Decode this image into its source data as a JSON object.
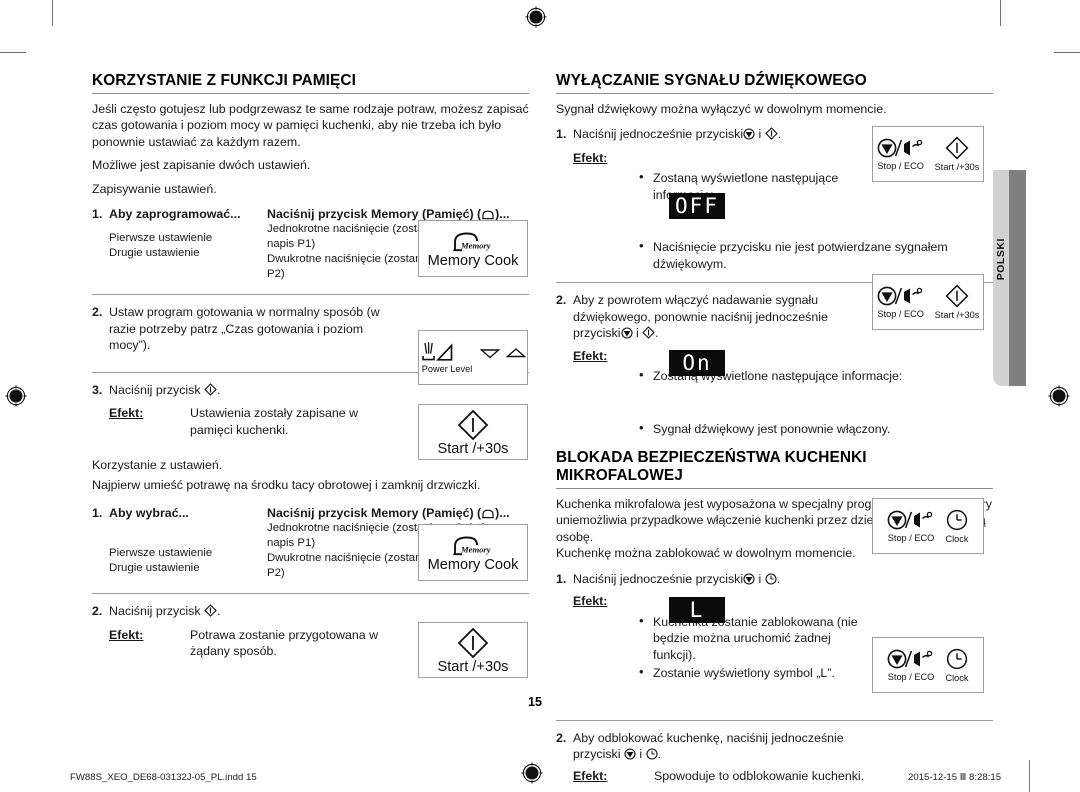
{
  "page": {
    "number": "15",
    "language_tab": "POLSKI",
    "footer_file": "FW88S_XEO_DE68-03132J-05_PL.indd   15",
    "footer_timestamp": "2015-12-15   Ⅲ 8:28:15"
  },
  "left_column": {
    "heading": "KORZYSTANIE Z FUNKCJI PAMIĘCI",
    "intro_1": "Jeśli często gotujesz lub podgrzewasz te same rodzaje potraw, możesz zapisać czas gotowania i poziom mocy w pamięci kuchenki, aby nie trzeba ich było ponownie ustawiać za każdym razem.",
    "intro_2": "Możliwe jest zapisanie dwóch ustawień.",
    "save_label": "Zapisywanie ustawień.",
    "step1": {
      "num": "1.",
      "col1_head": "Aby zaprogramować...",
      "col2_head": "Naciśnij przycisk Memory (Pamięć) (",
      "col2_head_tail": ")...",
      "rows": [
        {
          "c1": "Pierwsze ustawienie",
          "c2": "Jednokrotne naciśnięcie (zostanie wyświetlony napis P1)"
        },
        {
          "c1": "Drugie ustawienie",
          "c2": "Dwukrotne naciśnięcie (zostanie wyświetlony napis P2)"
        }
      ]
    },
    "step2": {
      "num": "2.",
      "text": "Ustaw program gotowania w normalny sposób (w razie potrzeby patrz „Czas gotowania i poziom mocy”)."
    },
    "step3": {
      "num": "3.",
      "text_pre": "Naciśnij przycisk ",
      "text_post": ".",
      "efekt_label": "Efekt:",
      "efekt_text": "Ustawienia zostały zapisane w pamięci kuchenki."
    },
    "use_label_1": "Korzystanie z ustawień.",
    "use_label_2": "Najpierw umieść potrawę na środku tacy obrotowej i zamknij drzwiczki.",
    "step4": {
      "num": "1.",
      "col1_head": "Aby wybrać...",
      "col2_head": "Naciśnij przycisk Memory (Pamięć) (",
      "col2_head_tail": ")...",
      "rows": [
        {
          "c1": "Pierwsze ustawienie",
          "c2": "Jednokrotne naciśnięcie (zostanie wyświetlony napis P1)"
        },
        {
          "c1": "Drugie ustawienie",
          "c2": "Dwukrotne naciśnięcie (zostanie wyświetlony napis P2)"
        }
      ]
    },
    "step5": {
      "num": "2.",
      "text_pre": "Naciśnij przycisk ",
      "text_post": ".",
      "efekt_label": "Efekt:",
      "efekt_text": "Potrawa zostanie przygotowana w żądany sposób."
    }
  },
  "right_column": {
    "heading_sound": "WYŁĄCZANIE SYGNAŁU DŹWIĘKOWEGO",
    "sound_intro": "Sygnał dźwiękowy można wyłączyć w dowolnym momencie.",
    "sound_step1": {
      "num": "1.",
      "text_pre": "Naciśnij jednocześnie przyciski",
      "text_mid": " i ",
      "text_post": ".",
      "efekt_label": "Efekt:",
      "bullet_1": "Zostaną wyświetlone następujące informacje:",
      "display_1": "OFF",
      "bullet_2": "Naciśnięcie przycisku nie jest potwierdzane sygnałem dźwiękowym."
    },
    "sound_step2": {
      "num": "2.",
      "text_pre": "Aby z powrotem włączyć nadawanie sygnału dźwiękowego, ponownie naciśnij jednocześnie przyciski",
      "text_mid": " i ",
      "text_post": ".",
      "efekt_label": "Efekt:",
      "bullet_1": "Zostaną wyświetlone następujące informacje:",
      "display_1": "On",
      "bullet_2": "Sygnał dźwiękowy jest ponownie włączony."
    },
    "heading_lock": "BLOKADA BEZPIECZEŃSTWA KUCHENKI MIKROFALOWEJ",
    "lock_intro_1": "Kuchenka mikrofalowa jest wyposażona w specjalny program blokowania, który uniemożliwia przypadkowe włączenie kuchenki przez dziecko lub niepowołaną osobę.",
    "lock_intro_2": "Kuchenkę można zablokować w dowolnym momencie.",
    "lock_step1": {
      "num": "1.",
      "text_pre": "Naciśnij jednocześnie przyciski",
      "text_mid": " i ",
      "text_post": ".",
      "efekt_label": "Efekt:",
      "bullet_1": "Kuchenka zostanie zablokowana (nie będzie można uruchomić żadnej funkcji).",
      "bullet_2": "Zostanie wyświetlony symbol „L”.",
      "display_1": "L"
    },
    "lock_step2": {
      "num": "2.",
      "text_pre": "Aby odblokować kuchenkę, naciśnij jednocześnie przyciski ",
      "text_mid": " i ",
      "text_post": ".",
      "efekt_label": "Efekt:",
      "efekt_text": "Spowoduje to odblokowanie kuchenki."
    }
  },
  "buttons": {
    "memory_cook": {
      "icon_label": "Memory",
      "caption": "Memory Cook"
    },
    "power_level": {
      "caption": "Power Level"
    },
    "start": {
      "caption": "Start /+30s"
    },
    "stop_eco": {
      "caption": "Stop / ECO"
    },
    "clock": {
      "caption": "Clock"
    }
  },
  "colors": {
    "rule": "#9a9a9a",
    "heading_rule": "#8b8b8b",
    "tab_light": "#d2d2d2",
    "tab_dark": "#7f7f7f",
    "lcd_bg": "#0b0b0b",
    "lcd_fg": "#ffffff"
  }
}
